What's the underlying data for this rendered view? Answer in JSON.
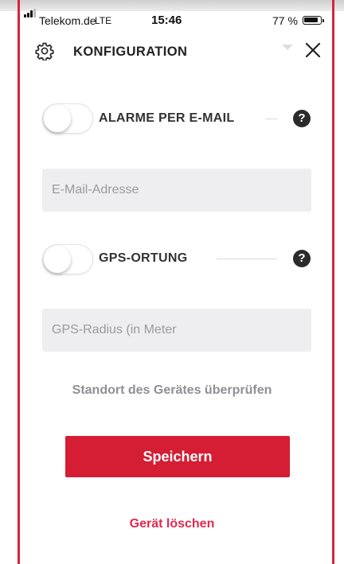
{
  "status_bar": {
    "carrier": "Telekom.de",
    "network": "LTE",
    "time": "15:46",
    "battery": "77 %"
  },
  "header": {
    "title": "KONFIGURATION"
  },
  "email_alarm": {
    "label": "ALARME PER E-MAIL",
    "enabled": false,
    "help": "?"
  },
  "email_field": {
    "placeholder": "E-Mail-Adresse",
    "value": ""
  },
  "gps": {
    "label": "GPS-ORTUNG",
    "enabled": false,
    "help": "?"
  },
  "gps_radius_field": {
    "placeholder": "GPS-Radius (in Meter",
    "value": ""
  },
  "check_location_label": "Standort des Gerätes überprüfen",
  "save_label": "Speichern",
  "delete_label": "Gerät löschen",
  "colors": {
    "accent": "#d51d33",
    "delete_text": "#e2284e",
    "field_bg": "#eeeef0",
    "border_line": "#d4253d"
  }
}
